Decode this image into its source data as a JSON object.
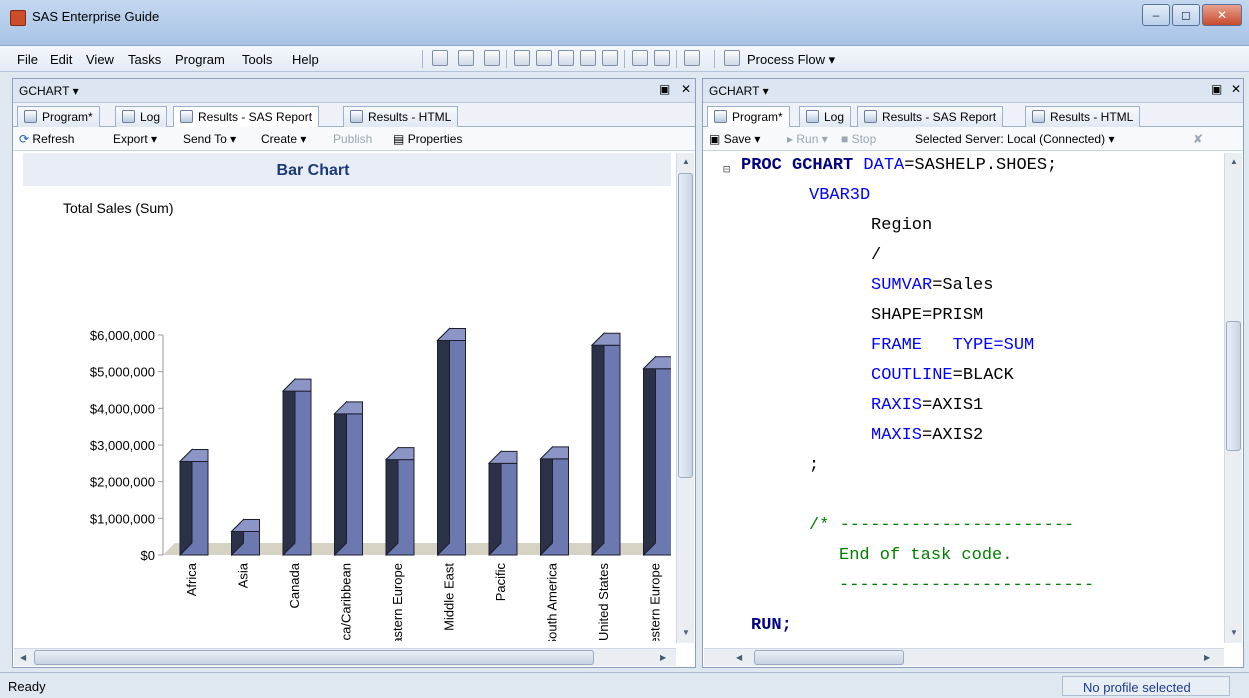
{
  "window": {
    "title": "SAS Enterprise Guide"
  },
  "menu": [
    "File",
    "Edit",
    "View",
    "Tasks",
    "Program",
    "Tools",
    "Help"
  ],
  "toolbar": {
    "process_flow": "Process Flow"
  },
  "left_pane": {
    "title": "GCHART",
    "tabs": [
      "Program*",
      "Log",
      "Results - SAS Report",
      "Results - HTML"
    ],
    "active_tab": "Results - SAS Report",
    "subtoolbar": {
      "refresh": "Refresh",
      "export": "Export",
      "send_to": "Send To",
      "create": "Create",
      "publish": "Publish",
      "properties": "Properties"
    }
  },
  "right_pane": {
    "title": "GCHART",
    "tabs": [
      "Program*",
      "Log",
      "Results - SAS Report",
      "Results - HTML"
    ],
    "active_tab": "Program*",
    "subtoolbar": {
      "save": "Save",
      "run": "Run",
      "stop": "Stop",
      "server": "Selected Server: Local (Connected)"
    },
    "code": [
      {
        "text": "PROC GCHART DATA=SASHELP.SHOES;"
      },
      {
        "text": "VBAR3D"
      },
      {
        "text": "Region"
      },
      {
        "text": "/"
      },
      {
        "text": "SUMVAR=Sales"
      },
      {
        "text": "SHAPE=PRISM"
      },
      {
        "text": "FRAME   TYPE=SUM"
      },
      {
        "text": "COUTLINE=BLACK"
      },
      {
        "text": "RAXIS=AXIS1"
      },
      {
        "text": "MAXIS=AXIS2"
      },
      {
        "text": ";"
      },
      {
        "text": "/* -----------------------"
      },
      {
        "text": "End of task code."
      },
      {
        "text": "-------------------------"
      },
      {
        "text": "RUN;"
      }
    ]
  },
  "chart_data": {
    "type": "bar",
    "title": "Bar Chart",
    "ylabel": "Total Sales (Sum)",
    "xlabel": "",
    "categories": [
      "Africa",
      "Asia",
      "Canada",
      "Central America/Caribbean",
      "Eastern Europe",
      "Middle East",
      "Pacific",
      "South America",
      "United States",
      "Western Europe"
    ],
    "values": [
      2550000,
      640000,
      4470000,
      3850000,
      2600000,
      5850000,
      2500000,
      2620000,
      5720000,
      5080000
    ],
    "yticks": [
      "$0",
      "$1,000,000",
      "$2,000,000",
      "$3,000,000",
      "$4,000,000",
      "$5,000,000",
      "$6,000,000"
    ],
    "ylim": [
      0,
      6000000
    ],
    "bar_color": "#6c79b1",
    "grid": false
  },
  "status": {
    "text": "Ready",
    "profile": "No profile selected"
  }
}
